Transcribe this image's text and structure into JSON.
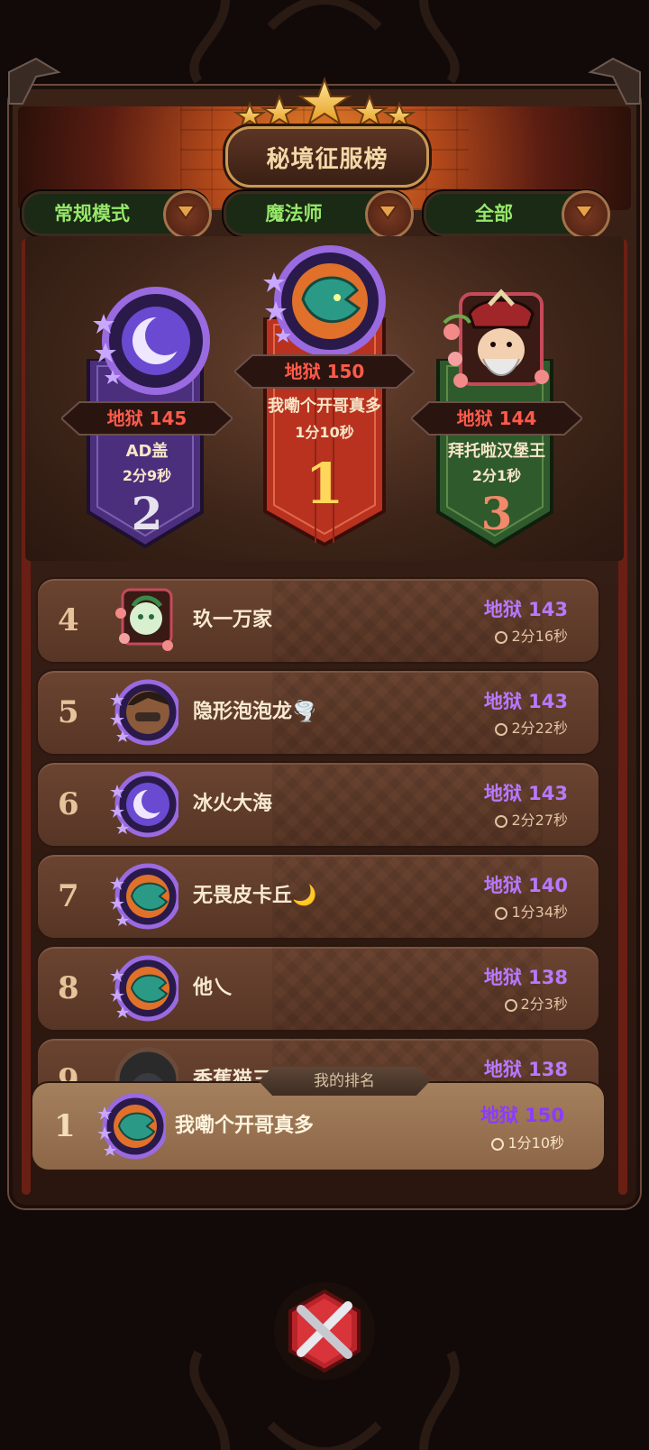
{
  "title": "秘境征服榜",
  "filters": [
    {
      "label": "常规模式"
    },
    {
      "label": "魔法师"
    },
    {
      "label": "全部"
    }
  ],
  "podium": [
    {
      "rank": "1",
      "score": "地狱 150",
      "name": "我嘞个开哥真多",
      "time": "1分10秒",
      "color": "#b8321f"
    },
    {
      "rank": "2",
      "score": "地狱 145",
      "name": "AD盖",
      "time": "2分9秒",
      "color": "#4b2f7d"
    },
    {
      "rank": "3",
      "score": "地狱 144",
      "name": "拜托啦汉堡王",
      "time": "2分1秒",
      "color": "#2f5a2c"
    }
  ],
  "rows": [
    {
      "rank": "4",
      "name": "玖一万家",
      "score": "地狱 143",
      "time": "2分16秒",
      "avatar": "flower-frame"
    },
    {
      "rank": "5",
      "name": "隐形泡泡龙🌪️",
      "score": "地狱 143",
      "time": "2分22秒",
      "avatar": "rogue"
    },
    {
      "rank": "6",
      "name": "冰火大海",
      "score": "地狱 143",
      "time": "2分27秒",
      "avatar": "moon"
    },
    {
      "rank": "7",
      "name": "无畏皮卡丘🌙",
      "score": "地狱 140",
      "time": "1分34秒",
      "avatar": "dragon"
    },
    {
      "rank": "8",
      "name": "他乀",
      "score": "地狱 138",
      "time": "2分3秒",
      "avatar": "dragon"
    },
    {
      "rank": "9",
      "name": "香蕉猫三",
      "score": "地狱 138",
      "time": "",
      "avatar": "hood"
    }
  ],
  "my_rank": {
    "label": "我的排名",
    "rank": "1",
    "name": "我嘞个开哥真多",
    "score": "地狱 150",
    "time": "1分10秒"
  },
  "colors": {
    "score_purple": "#b878ff",
    "filter_green": "#96e86a",
    "podium_red": "#ff5a4a"
  }
}
